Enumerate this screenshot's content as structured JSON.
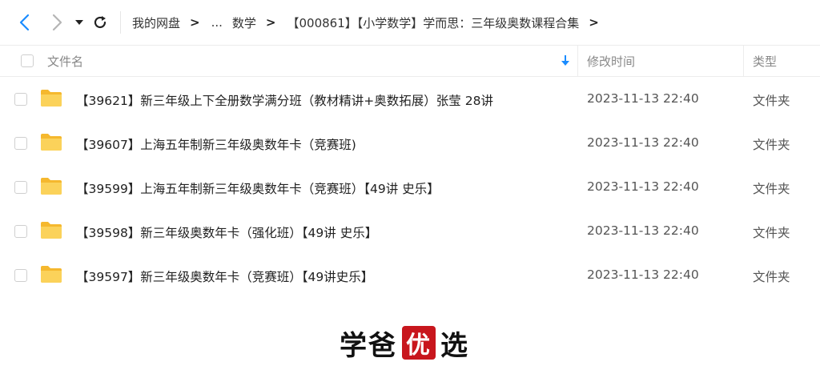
{
  "toolbar": {
    "back_icon": "chevron-left-icon",
    "forward_icon": "chevron-right-icon",
    "dropdown_icon": "caret-down-icon",
    "refresh_icon": "refresh-icon"
  },
  "breadcrumb": {
    "items": [
      "我的网盘",
      "...",
      "数学",
      "【000861】【小学数学】学而思：三年级奥数课程合集"
    ],
    "separator": ">"
  },
  "table": {
    "headers": {
      "name": "文件名",
      "time": "修改时间",
      "type": "类型"
    },
    "sort_icon": "sort-down-arrow-icon",
    "rows": [
      {
        "name": "【39621】新三年级上下全册数学满分班（教材精讲+奥数拓展）张莹 28讲",
        "time": "2023-11-13 22:40",
        "type": "文件夹"
      },
      {
        "name": "【39607】上海五年制新三年级奥数年卡（竞赛班)",
        "time": "2023-11-13 22:40",
        "type": "文件夹"
      },
      {
        "name": "【39599】上海五年制新三年级奥数年卡（竞赛班）【49讲 史乐】",
        "time": "2023-11-13 22:40",
        "type": "文件夹"
      },
      {
        "name": "【39598】新三年级奥数年卡（强化班）【49讲 史乐】",
        "time": "2023-11-13 22:40",
        "type": "文件夹"
      },
      {
        "name": "【39597】新三年级奥数年卡（竞赛班）【49讲史乐】",
        "time": "2023-11-13 22:40",
        "type": "文件夹"
      }
    ]
  },
  "watermark": {
    "text_before": "学爸",
    "stamp": "优",
    "text_after": "选"
  },
  "colors": {
    "accent": "#1a8cff",
    "folder": "#f7c744",
    "stamp": "#c8161d"
  }
}
